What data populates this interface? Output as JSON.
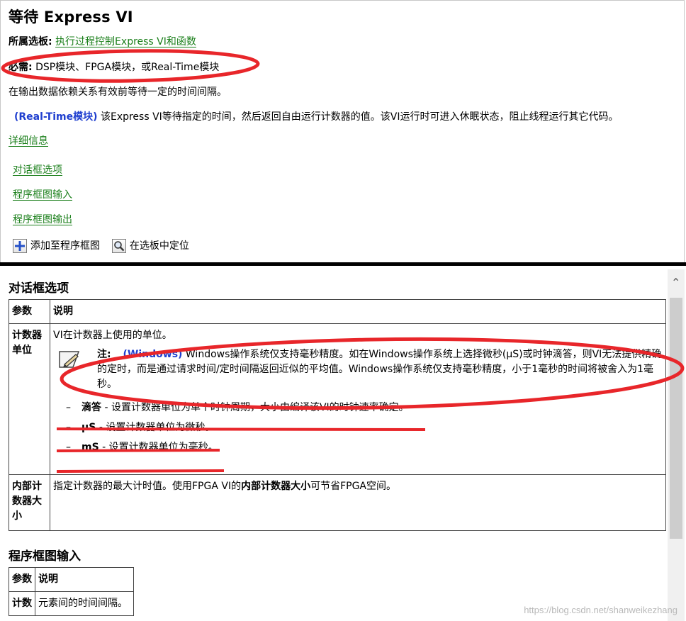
{
  "page": {
    "title": "等待 Express VI",
    "palette_label": "所属选板:",
    "palette_link": "执行过程控制Express VI和函数",
    "requires_label": "必需:",
    "requires_value": "DSP模块、FPGA模块，或Real-Time模块",
    "description": "在输出数据依赖关系有效前等待一定的时间间隔。",
    "rt_label": "(Real-Time模块)",
    "rt_text": "该Express VI等待指定的时间，然后返回自由运行计数器的值。该VI运行时可进入休眠状态，阻止线程运行其它代码。",
    "detail_link": "详细信息",
    "links": [
      "对话框选项",
      "程序框图输入",
      "程序框图输出"
    ],
    "add_to_diagram": "添加至程序框图",
    "locate_in_palette": "在选板中定位"
  },
  "dialog_options": {
    "heading": "对话框选项",
    "col_param": "参数",
    "col_desc": "说明",
    "row1_param": "计数器单位",
    "row1_desc": "VI在计数器上使用的单位。",
    "note_label": "注:",
    "note_windows": "(Windows)",
    "note_text": "Windows操作系统仅支持毫秒精度。如在Windows操作系统上选择微秒(μS)或时钟滴答，则VI无法提供精确的定时，而是通过请求时间/定时间隔返回近似的平均值。Windows操作系统仅支持毫秒精度，小于1毫秒的时间将被舍入为1毫秒。",
    "bullets": [
      {
        "dash": "–",
        "term": "滴答",
        "text": " - 设置计数器单位为单个时钟周期，大小由编译该VI的时钟速率确定。"
      },
      {
        "dash": "–",
        "term": "μS",
        "text": " - 设置计数器单位为微秒。"
      },
      {
        "dash": "–",
        "term": "mS",
        "text": " - 设置计数器单位为毫秒。"
      }
    ],
    "row2_param": "内部计数器大小",
    "row2_desc_a": "指定计数器的最大计时值。使用FPGA VI的",
    "row2_desc_b": "内部计数器大小",
    "row2_desc_c": "可节省FPGA空间。"
  },
  "diagram_inputs": {
    "heading": "程序框图输入",
    "col_param": "参数",
    "col_desc": "说明",
    "row1_param": "计数",
    "row1_desc": "元素间的时间间隔。"
  },
  "watermark": "https://blog.csdn.net/shanweikezhang",
  "colors": {
    "link": "#1a7f1a",
    "accent_blue": "#1f3fcf",
    "annotation_red": "#e8262a"
  }
}
